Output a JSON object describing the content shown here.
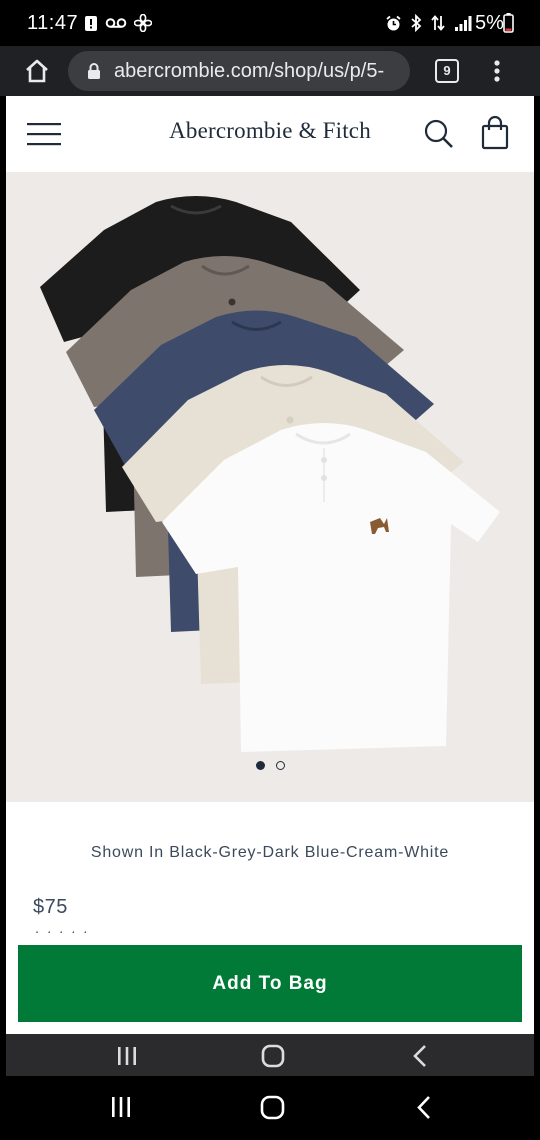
{
  "status_bar": {
    "time": "11:47",
    "battery": "5%"
  },
  "browser": {
    "url": "abercrombie.com/shop/us/p/5-",
    "tab_count": "9"
  },
  "site": {
    "brand": "Abercrombie & Fitch"
  },
  "product": {
    "shown_in": "Shown In Black-Grey-Dark Blue-Cream-White",
    "price": "$75",
    "add_to_bag_label": "Add To Bag",
    "image_count": 2,
    "active_image": 1,
    "colors": {
      "black": "#1c1c1c",
      "grey": "#7d746e",
      "dark_blue": "#3f4b6b",
      "cream": "#e7e1d5",
      "white": "#fbfbfb"
    }
  },
  "theme": {
    "add_to_bag_color": "#017a37",
    "brand_text_color": "#1f2b3a",
    "hero_background": "#eeeae7"
  },
  "icons": {
    "browser": [
      "home-icon",
      "lock-icon",
      "tabs-icon",
      "more-vert-icon"
    ],
    "site": [
      "hamburger-menu-icon",
      "search-icon",
      "shopping-bag-icon"
    ],
    "status": [
      "alert-icon",
      "voicemail-icon",
      "fan-icon",
      "alarm-icon",
      "bluetooth-icon",
      "data-arrows-icon",
      "signal-icon",
      "battery-icon"
    ],
    "nav": [
      "recent-apps-icon",
      "home-circle-icon",
      "back-icon"
    ]
  }
}
